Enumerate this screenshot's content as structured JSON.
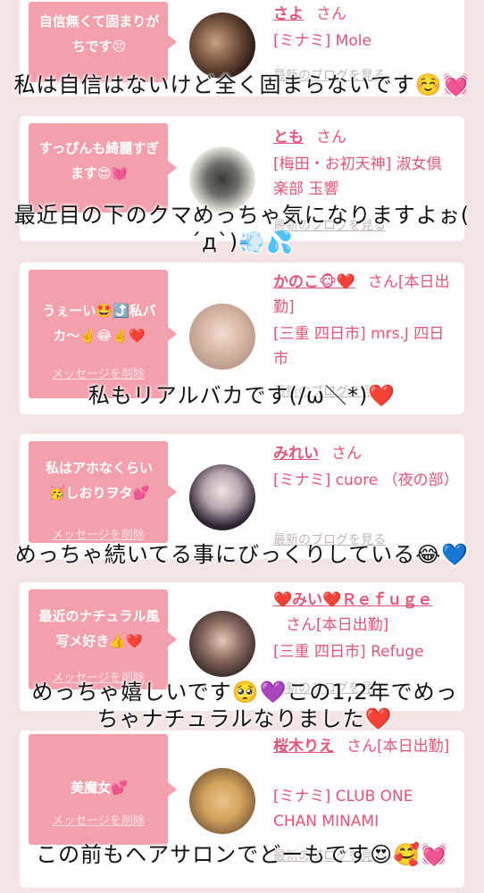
{
  "delete_message_label": "メッセージを削除",
  "view_blog_label": "最新のブログを見る",
  "cards": [
    {
      "bubble": "自信無くて固まりがちです😣",
      "name": "さよ",
      "suffix": "さん",
      "shop": "[ミナミ] Mole",
      "caption": "私は自信はないけど全く固まらないです☺️💓"
    },
    {
      "bubble": "すっぴんも綺麗すぎます😍💓",
      "name": "とも",
      "suffix": "さん",
      "shop": "[梅田・お初天神] 淑女倶楽部 玉響",
      "caption": "最近目の下のクマめっちゃ気になりますよぉ( ´д`)💨💦"
    },
    {
      "bubble": "うぇーい🤩⤴️私バカ〜✌️😂✌️❤️",
      "name": "かのこ🐵❤️",
      "suffix": "さん[本日出勤]",
      "shop": "[三重 四日市] mrs.J 四日市",
      "caption": "私もリアルバカです(/ω＼*)❤️"
    },
    {
      "bubble": "私はアホなくらい🥳しおりヲタ💕",
      "name": "みれい",
      "suffix": "さん",
      "shop": "[ミナミ] cuore （夜の部）",
      "caption": "めっちゃ続いてる事にびっくりしている😂💙"
    },
    {
      "bubble": "最近のナチュラル風写メ好き👍❤️",
      "name": "❤️みい❤️Ｒｅｆｕｇｅ",
      "suffix": "さん[本日出勤]",
      "shop": "[三重 四日市] Refuge",
      "caption": "めっちゃ嬉しいです🥺💜この1,2年でめっちゃナチュラルなりました❤️"
    },
    {
      "bubble": "美魔女💕",
      "name": "桜木りえ",
      "suffix": "さん[本日出勤]",
      "shop": "[ミナミ] CLUB ONE CHAN MINAMI",
      "caption": "この前もヘアサロンでどーもです😍🥰💓"
    }
  ],
  "colors": {
    "background": "#f5e4e4",
    "bubble": "#f3a0ac",
    "name_pink": "#e25578",
    "card": "#ffffff"
  }
}
